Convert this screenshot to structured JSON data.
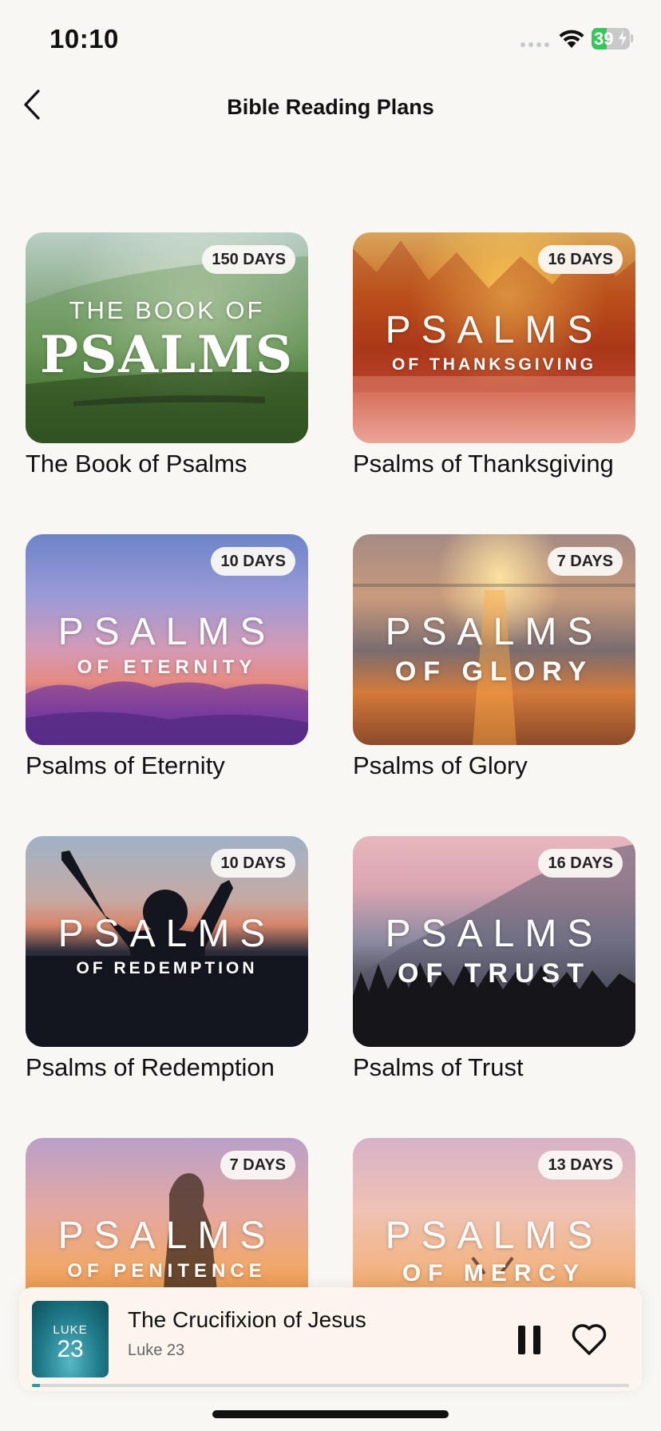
{
  "status": {
    "time": "10:10",
    "battery_percent": "39",
    "battery_level": 0.39
  },
  "header": {
    "title": "Bible Reading Plans"
  },
  "plans": [
    {
      "title": "The Book of Psalms",
      "badge": "150 DAYS",
      "cover_line1": "THE BOOK OF",
      "cover_line2": "PSALMS"
    },
    {
      "title": "Psalms of Thanksgiving",
      "badge": "16 DAYS",
      "cover_line1": "PSALMS",
      "cover_line2": "OF THANKSGIVING"
    },
    {
      "title": "Psalms of Eternity",
      "badge": "10 DAYS",
      "cover_line1": "PSALMS",
      "cover_line2": "OF ETERNITY"
    },
    {
      "title": "Psalms of Glory",
      "badge": "7 DAYS",
      "cover_line1": "PSALMS",
      "cover_line2": "OF GLORY"
    },
    {
      "title": "Psalms of Redemption",
      "badge": "10 DAYS",
      "cover_line1": "PSALMS",
      "cover_line2": "OF REDEMPTION"
    },
    {
      "title": "Psalms of Trust",
      "badge": "16 DAYS",
      "cover_line1": "PSALMS",
      "cover_line2": "OF TRUST"
    },
    {
      "title": "",
      "badge": "7 DAYS",
      "cover_line1": "PSALMS",
      "cover_line2": "OF PENITENCE"
    },
    {
      "title": "",
      "badge": "13 DAYS",
      "cover_line1": "PSALMS",
      "cover_line2": "OF MERCY"
    }
  ],
  "now_playing": {
    "title": "The Crucifixion of Jesus",
    "subtitle": "Luke 23",
    "art_book": "LUKE",
    "art_chapter": "23",
    "progress": 0.013
  },
  "colors": {
    "background": "#f8f7f3",
    "battery_green": "#34c759",
    "progress_accent": "#2a9aa4"
  },
  "icons": {
    "back": "chevron-left-icon",
    "wifi": "wifi-icon",
    "pause": "pause-icon",
    "heart": "heart-icon"
  }
}
